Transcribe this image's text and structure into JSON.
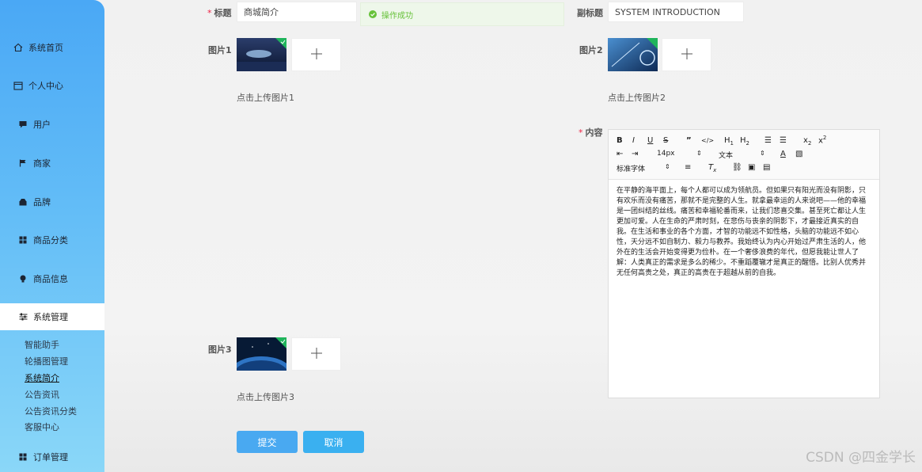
{
  "sidebar": {
    "items": [
      {
        "label": "系统首页",
        "icon": "home-icon"
      },
      {
        "label": "个人中心",
        "icon": "calendar-icon"
      },
      {
        "label": "用户",
        "icon": "chat-icon"
      },
      {
        "label": "商家",
        "icon": "flag-icon"
      },
      {
        "label": "品牌",
        "icon": "shop-icon"
      },
      {
        "label": "商品分类",
        "icon": "grid-icon"
      },
      {
        "label": "商品信息",
        "icon": "bulb-icon"
      },
      {
        "label": "系统管理",
        "icon": "sliders-icon"
      },
      {
        "label": "订单管理",
        "icon": "grid-icon"
      }
    ],
    "sub_items": [
      "智能助手",
      "轮播图管理",
      "系统简介",
      "公告资讯",
      "公告资讯分类",
      "客服中心"
    ]
  },
  "form": {
    "title_label": "标题",
    "title_value": "商城简介",
    "subtitle_label": "副标题",
    "subtitle_value": "SYSTEM INTRODUCTION",
    "toast": "操作成功",
    "img1_label": "图片1",
    "img1_hint": "点击上传图片1",
    "img2_label": "图片2",
    "img2_hint": "点击上传图片2",
    "img3_label": "图片3",
    "img3_hint": "点击上传图片3",
    "content_label": "内容",
    "submit": "提交",
    "cancel": "取消"
  },
  "editor": {
    "font_size": "14px",
    "text_style": "文本",
    "font_family": "标准字体",
    "content": "在平静的海平面上，每个人都可以成为领航员。但如果只有阳光而没有阴影，只有欢乐而没有痛苦，那就不是完整的人生。就拿最幸运的人来说吧——他的幸福是一团纠结的丝线。痛苦和幸福轮番而来，让我们悲喜交集。甚至死亡都让人生更加可爱。人在生命的严肃时刻，在悲伤与丧亲的阴影下，才最接近真实的自我。在生活和事业的各个方面，才智的功能远不如性格，头脑的功能远不如心性，天分远不如自制力、毅力与教养。我始终认为内心开始过严肃生活的人，他外在的生活会开始变得更为俭朴。在一个奢侈浪费的年代，但愿我能让世人了解：人类真正的需求是多么的稀少。不重蹈覆辙才是真正的醒悟。比别人优秀并无任何高贵之处，真正的高贵在于超越从前的自我。"
  },
  "watermark": "CSDN @四金学长",
  "colors": {
    "primary": "#49a9f1",
    "success": "#67c23a",
    "required": "#e24"
  }
}
